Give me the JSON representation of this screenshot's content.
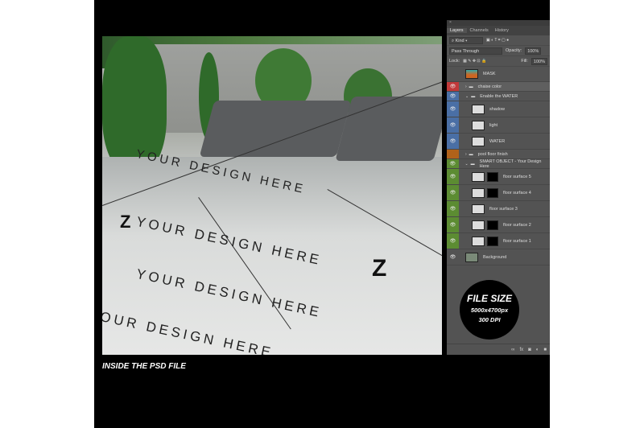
{
  "panel": {
    "close": "×",
    "tabs": [
      "Layers",
      "Channels",
      "History"
    ],
    "kind": "Kind",
    "blend": "Pass Through",
    "opacity_label": "Opacity:",
    "opacity": "100%",
    "lock_label": "Lock:",
    "fill_label": "Fill:",
    "fill": "100%",
    "layers": [
      {
        "name": "MASK",
        "color": "#535353",
        "eye": false,
        "type": "mask"
      },
      {
        "name": "chaise color",
        "color": "#c1393a",
        "eye": true,
        "type": "group"
      },
      {
        "name": "Enable the WATER",
        "color": "#4a6fa5",
        "eye": true,
        "type": "group-open"
      },
      {
        "name": "shadow",
        "color": "#4a6fa5",
        "eye": true,
        "type": "layer"
      },
      {
        "name": "light",
        "color": "#4a6fa5",
        "eye": true,
        "type": "layer"
      },
      {
        "name": "WATER",
        "color": "#4a6fa5",
        "eye": true,
        "type": "layer"
      },
      {
        "name": "pool floor finish",
        "color": "#b0621a",
        "eye": false,
        "type": "group"
      },
      {
        "name": "SMART OBJECT - Your Design Here",
        "color": "#5c8c32",
        "eye": true,
        "type": "group-open"
      },
      {
        "name": "floor surface 5",
        "color": "#5c8c32",
        "eye": true,
        "type": "smart"
      },
      {
        "name": "floor surface 4",
        "color": "#5c8c32",
        "eye": true,
        "type": "smart"
      },
      {
        "name": "floor surface 3",
        "color": "#5c8c32",
        "eye": true,
        "type": "smart"
      },
      {
        "name": "floor surface 2",
        "color": "#5c8c32",
        "eye": true,
        "type": "smart"
      },
      {
        "name": "floor surface 1",
        "color": "#5c8c32",
        "eye": true,
        "type": "smart"
      },
      {
        "name": "Background",
        "color": "#535353",
        "eye": true,
        "type": "layer"
      }
    ]
  },
  "badge": {
    "title": "FILE SIZE",
    "size": "5000x4700px",
    "dpi": "300 DPI"
  },
  "photo": {
    "watermark": "YOUR DESIGN HERE",
    "logo": "Z"
  },
  "caption": "INSIDE THE PSD FILE"
}
